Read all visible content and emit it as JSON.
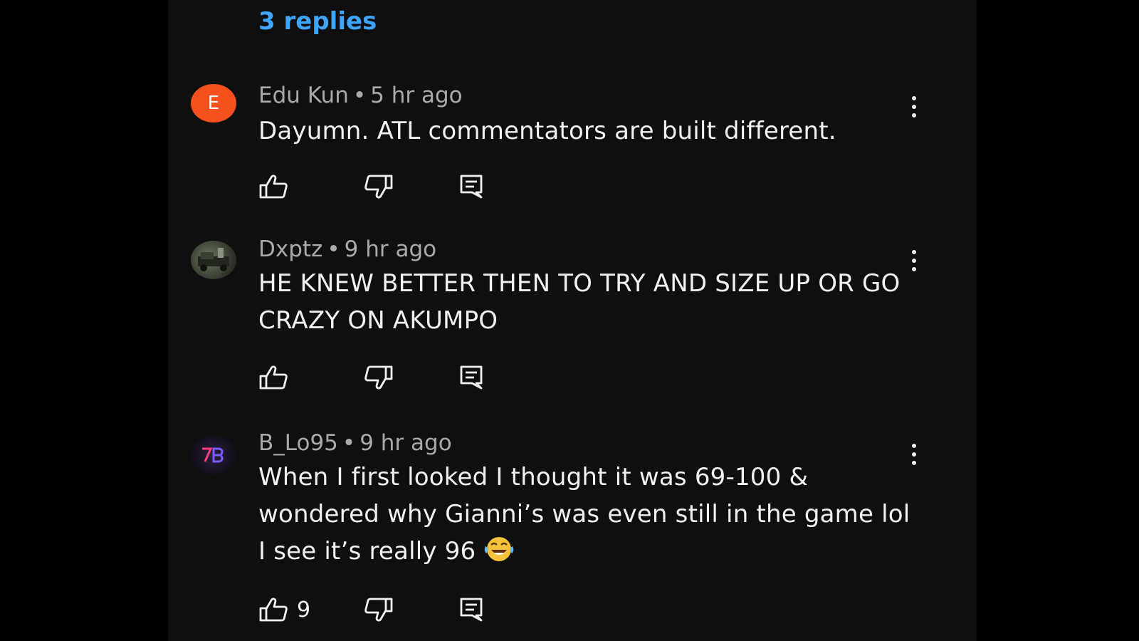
{
  "thread": {
    "replies_label": "3 replies"
  },
  "comments": [
    {
      "avatar_letter": "E",
      "avatar_color": "#f4511e",
      "author": "Edu Kun",
      "separator": "•",
      "time": "5 hr ago",
      "text": "Dayumn. ATL commentators are built different.",
      "like_count": ""
    },
    {
      "avatar_letter": "",
      "author": "Dxptz",
      "separator": "•",
      "time": "9 hr ago",
      "text": "HE KNEW BETTER THEN TO TRY AND SIZE UP OR GO CRAZY ON AKUMPO",
      "like_count": ""
    },
    {
      "avatar_letter": "",
      "author": "B_Lo95",
      "separator": "•",
      "time": "9 hr ago",
      "text": "When I first looked I thought it was 69-100 & wondered why Gianni’s was even still in the game lol I see it’s really 96",
      "emoji": "face-with-tears-of-joy",
      "like_count": "9"
    }
  ],
  "icons": {
    "like": "thumbs-up-icon",
    "dislike": "thumbs-down-icon",
    "reply": "reply-icon",
    "menu": "more-vert-icon"
  },
  "colors": {
    "background": "#000000",
    "panel": "#0f0f0f",
    "link": "#3ea6ff",
    "text_primary": "#f1f1f1",
    "text_secondary": "#aaaaaa"
  }
}
